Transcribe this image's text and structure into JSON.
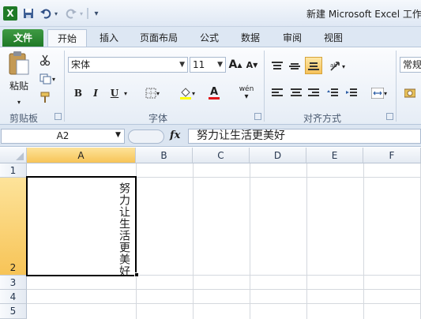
{
  "title_bar": {
    "title": "新建 Microsoft Excel 工作",
    "excel_icon": "X",
    "quick_access": [
      "save-icon",
      "undo-icon",
      "redo-icon",
      "customize-icon"
    ]
  },
  "tabs": [
    {
      "label": "文件"
    },
    {
      "label": "开始"
    },
    {
      "label": "插入"
    },
    {
      "label": "页面布局"
    },
    {
      "label": "公式"
    },
    {
      "label": "数据"
    },
    {
      "label": "审阅"
    },
    {
      "label": "视图"
    }
  ],
  "ribbon": {
    "clipboard": {
      "paste_label": "粘贴",
      "group_label": "剪贴板"
    },
    "font": {
      "font_name": "宋体",
      "font_size": "11",
      "bold": "B",
      "italic": "I",
      "underline": "U",
      "grow": "A",
      "shrink": "A",
      "font_color_letter": "A",
      "phonetic": "wén",
      "group_label": "字体"
    },
    "alignment": {
      "group_label": "对齐方式"
    },
    "number": {
      "format_label": "常规"
    }
  },
  "formula_bar": {
    "name_box": "A2",
    "fx": "fx",
    "content": "努力让生活更美好"
  },
  "sheet": {
    "columns": [
      "A",
      "B",
      "C",
      "D",
      "E",
      "F"
    ],
    "rows": [
      "1",
      "2",
      "3",
      "4",
      "5"
    ],
    "selected_cell": "A2",
    "cells": {
      "A2": "努力让生活更美好"
    }
  },
  "colors": {
    "file_tab": "#1f7a27",
    "selection_header": "#f7c457",
    "ribbon_bg": "#e6edf6"
  }
}
